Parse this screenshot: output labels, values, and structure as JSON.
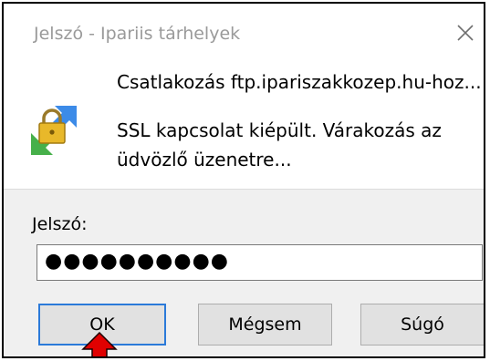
{
  "window": {
    "title": "Jelszó - Ipariis tárhelyek",
    "close_icon": "close-icon"
  },
  "message": {
    "line1": "Csatlakozás ftp.ipariszakkozep.hu-hoz...",
    "line2": "SSL kapcsolat kiépült. Várakozás az üdvözlő üzenetre..."
  },
  "password": {
    "label": "Jelszó:",
    "value": "●●●●●●●●●●"
  },
  "buttons": {
    "ok": "OK",
    "cancel": "Mégsem",
    "help": "Súgó"
  },
  "colors": {
    "accent_focus": "#2b7ad9",
    "annotation_arrow": "#e00000"
  },
  "icons": {
    "app": "padlock-sync-arrows-icon",
    "annotation": "red-up-arrow-icon"
  }
}
